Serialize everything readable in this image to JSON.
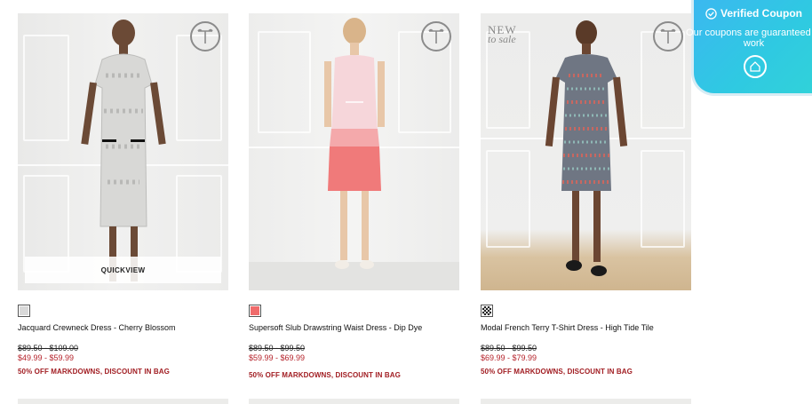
{
  "products": [
    {
      "name": "Jacquard Crewneck Dress - Cherry Blossom",
      "original_price": "$89.50 - $109.00",
      "sale_price": "$49.99 - $59.99",
      "promo": "50% OFF MARKDOWNS, DISCOUNT IN BAG",
      "quickview": "QUICKVIEW",
      "swatch_color": "#d9d9d9"
    },
    {
      "name": "Supersoft Slub Drawstring Waist Dress - Dip Dye",
      "original_price": "$89.50 - $99.50",
      "sale_price": "$59.99 - $69.99",
      "promo": "50% OFF MARKDOWNS, DISCOUNT IN BAG",
      "swatch_color": "#f06b6b"
    },
    {
      "name": "Modal French Terry T-Shirt Dress - High Tide Tile",
      "original_price": "$89.50 - $99.50",
      "sale_price": "$69.99 - $79.99",
      "promo": "50% OFF MARKDOWNS, DISCOUNT IN BAG",
      "badge_line1": "NEW",
      "badge_line2": "to sale",
      "swatch_color": "#3b3b3b"
    }
  ],
  "coupon_widget": {
    "title": "Verified Coupon",
    "message": "Our coupons are guaranteed to work",
    "accent": "#3bb8f0"
  },
  "brand_icon": "talbots-t-logo",
  "colors": {
    "sale": "#b5222a",
    "promo": "#a11d22"
  }
}
